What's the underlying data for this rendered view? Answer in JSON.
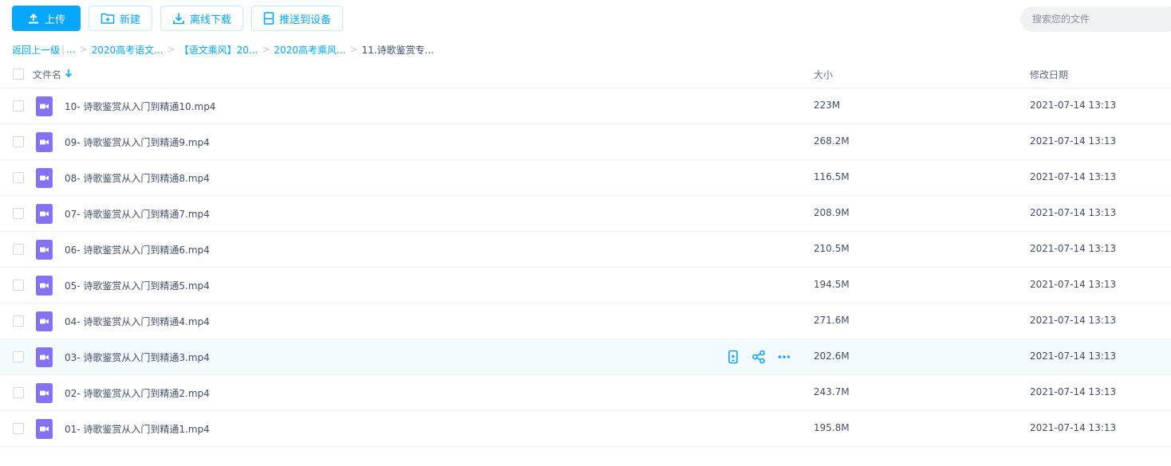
{
  "toolbar": {
    "upload_label": "上传",
    "new_label": "新建",
    "offline_label": "离线下载",
    "push_label": "推送到设备"
  },
  "search": {
    "placeholder": "搜索您的文件"
  },
  "breadcrumb": {
    "back": "返回上一级",
    "ellipsis": "...",
    "items": [
      "2020高考语文...",
      "【语文乘风】20...",
      "2020高考乘风..."
    ],
    "current": "11.诗歌鉴赏专..."
  },
  "table": {
    "headers": {
      "name": "文件名",
      "size": "大小",
      "date": "修改日期"
    },
    "rows": [
      {
        "name": "10- 诗歌鉴赏从入门到精通10.mp4",
        "size": "223M",
        "date": "2021-07-14 13:13"
      },
      {
        "name": "09- 诗歌鉴赏从入门到精通9.mp4",
        "size": "268.2M",
        "date": "2021-07-14 13:13"
      },
      {
        "name": "08- 诗歌鉴赏从入门到精通8.mp4",
        "size": "116.5M",
        "date": "2021-07-14 13:13"
      },
      {
        "name": "07- 诗歌鉴赏从入门到精通7.mp4",
        "size": "208.9M",
        "date": "2021-07-14 13:13"
      },
      {
        "name": "06- 诗歌鉴赏从入门到精通6.mp4",
        "size": "210.5M",
        "date": "2021-07-14 13:13"
      },
      {
        "name": "05- 诗歌鉴赏从入门到精通5.mp4",
        "size": "194.5M",
        "date": "2021-07-14 13:13"
      },
      {
        "name": "04- 诗歌鉴赏从入门到精通4.mp4",
        "size": "271.6M",
        "date": "2021-07-14 13:13"
      },
      {
        "name": "03- 诗歌鉴赏从入门到精通3.mp4",
        "size": "202.6M",
        "date": "2021-07-14 13:13"
      },
      {
        "name": "02- 诗歌鉴赏从入门到精通2.mp4",
        "size": "243.7M",
        "date": "2021-07-14 13:13"
      },
      {
        "name": "01- 诗歌鉴赏从入门到精通1.mp4",
        "size": "195.8M",
        "date": "2021-07-14 13:13"
      }
    ]
  },
  "hovered_row": 7,
  "icons": {
    "file": "video-file-icon",
    "row_actions": [
      "phone-push-icon",
      "share-icon",
      "more-icon"
    ]
  },
  "colors": {
    "accent": "#06a7ff",
    "video_icon": "#8572f3",
    "hover_row": "#f4fbff"
  }
}
